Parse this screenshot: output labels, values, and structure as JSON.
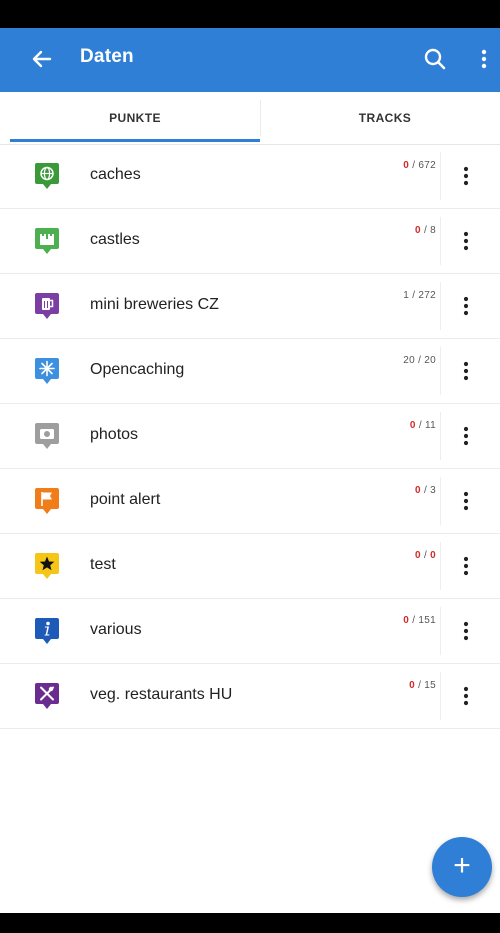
{
  "appbar": {
    "title": "Daten",
    "back_icon": "arrow-left-icon",
    "search_icon": "search-icon",
    "more_icon": "more-vertical-icon",
    "color": "#2f7fd6"
  },
  "tabs": [
    {
      "label": "PUNKTE",
      "active": true
    },
    {
      "label": "TRACKS",
      "active": false
    }
  ],
  "items": [
    {
      "label": "caches",
      "selected": "0",
      "total": "672",
      "icon": "globe-pin-icon",
      "color": "#3a9a3a"
    },
    {
      "label": "castles",
      "selected": "0",
      "total": "8",
      "icon": "castle-pin-icon",
      "color": "#4caf50"
    },
    {
      "label": "mini breweries CZ",
      "selected": "1",
      "total": "272",
      "icon": "beer-pin-icon",
      "color": "#7b3fa3"
    },
    {
      "label": "Opencaching",
      "selected": "20",
      "total": "20",
      "icon": "star-burst-pin-icon",
      "color": "#3d8fe0"
    },
    {
      "label": "photos",
      "selected": "0",
      "total": "11",
      "icon": "camera-pin-icon",
      "color": "#9e9e9e"
    },
    {
      "label": "point alert",
      "selected": "0",
      "total": "3",
      "icon": "flag-pin-icon",
      "color": "#f07d1a"
    },
    {
      "label": "test",
      "selected": "0",
      "total": "0",
      "icon": "star-pin-icon",
      "color": "#f5c518"
    },
    {
      "label": "various",
      "selected": "0",
      "total": "151",
      "icon": "info-pin-icon",
      "color": "#1e5bb8"
    },
    {
      "label": "veg. restaurants HU",
      "selected": "0",
      "total": "15",
      "icon": "cutlery-pin-icon",
      "color": "#6a2c8f"
    }
  ],
  "fab": {
    "label": "+",
    "icon": "add-icon"
  }
}
